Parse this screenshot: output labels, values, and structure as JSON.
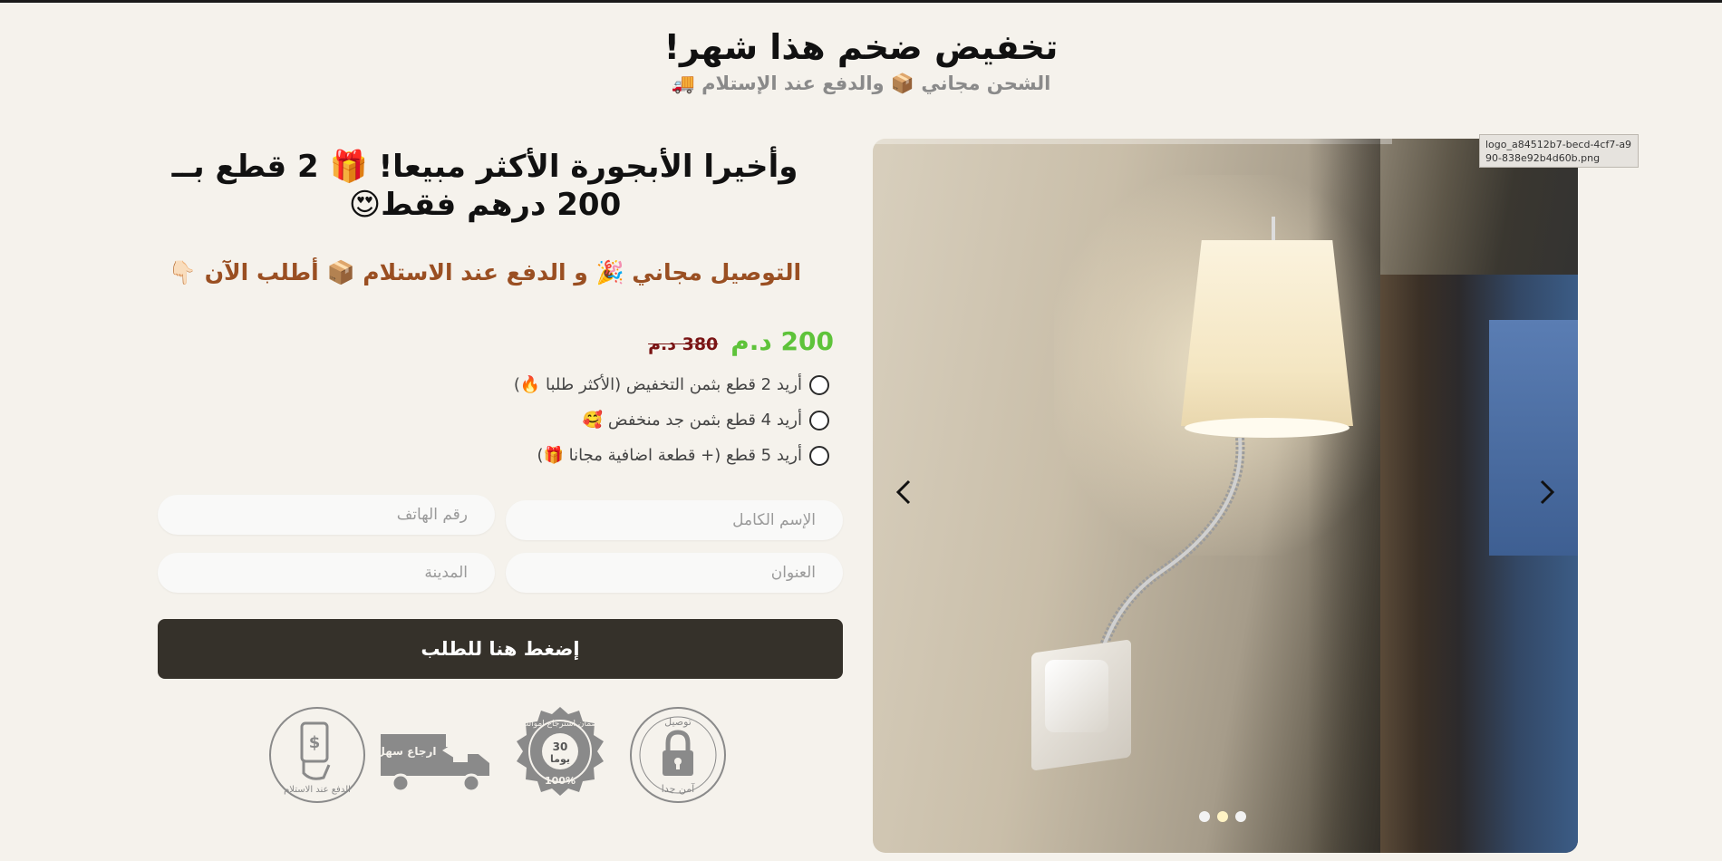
{
  "hero": {
    "title": "تخفيض ضخم هذا شهر!",
    "subtitle": "الشحن مجاني 📦 والدفع عند الإستلام 🚚"
  },
  "offer": {
    "headline": "وأخيرا الأبجورة الأكثر مبيعا! 🎁 2 قطع بــ 200 درهم فقط😍",
    "subline": "التوصيل مجاني 🎉 و الدفع عند الاستلام 📦 أطلب الآن 👇🏻"
  },
  "price": {
    "current": "200 د.م",
    "original": "380 د.م"
  },
  "options": [
    {
      "label": "أريد 2 قطع بثمن التخفيض (الأكثر طلبا 🔥)",
      "selected": false
    },
    {
      "label": "أريد 4 قطع بثمن جد منخفض 🥰",
      "selected": false
    },
    {
      "label": "أريد 5 قطع (+ قطعة اضافية مجانا 🎁)",
      "selected": false
    }
  ],
  "form": {
    "name_placeholder": "الإسم الكامل",
    "phone_placeholder": "رقم الهاتف",
    "address_placeholder": "العنوان",
    "city_placeholder": "المدينة",
    "submit_label": "إضغط هنا للطلب"
  },
  "badges": {
    "cod": "الدفع عند الاستلام",
    "return_easy": "ارجاع سهل",
    "guarantee_ring": "ضمان استرجاع اموالك",
    "guarantee_days": "30",
    "guarantee_days_unit": "يوما",
    "guarantee_percent": "100%",
    "secure_top": "توصيل",
    "secure_bottom": "آمن جدا"
  },
  "gallery": {
    "logo_filename": "logo_a84512b7-becd-4cf7-a990-838e92b4d60b.png",
    "slide_count": 3,
    "active_slide": 1,
    "prev_icon": "chevron-left-icon",
    "next_icon": "chevron-right-icon"
  },
  "colors": {
    "background": "#f5f2ec",
    "accent_price": "#5ec33a",
    "old_price": "#7a1414",
    "subline": "#9a4f22",
    "button": "#35312a"
  }
}
